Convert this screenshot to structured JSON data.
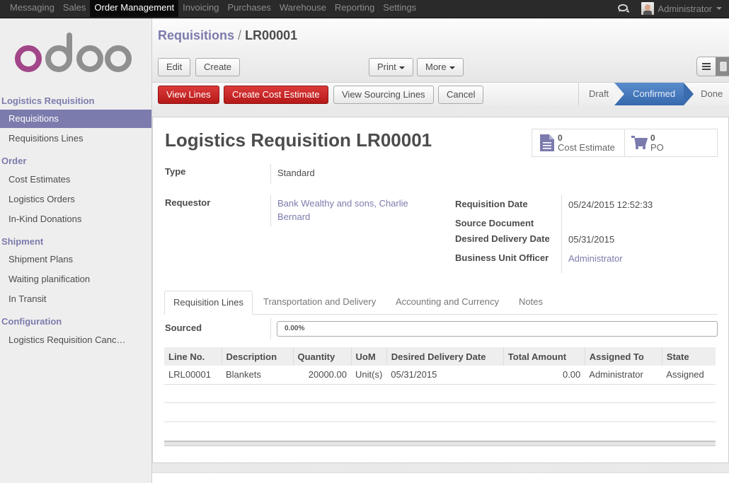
{
  "topbar": {
    "menu": [
      "Messaging",
      "Sales",
      "Order Management",
      "Invoicing",
      "Purchases",
      "Warehouse",
      "Reporting",
      "Settings"
    ],
    "active_menu": "Order Management",
    "user": "Administrator",
    "icons": {
      "chat": "chat-bubbles-icon",
      "avatar": "user-avatar",
      "user_menu": "caret-down-icon"
    }
  },
  "sidebar": {
    "logo_text": "odoo",
    "sections": [
      {
        "heading": "Logistics Requisition",
        "items": [
          "Requisitions",
          "Requisitions Lines"
        ]
      },
      {
        "heading": "Order",
        "items": [
          "Cost Estimates",
          "Logistics Orders",
          "In-Kind Donations"
        ]
      },
      {
        "heading": "Shipment",
        "items": [
          "Shipment Plans",
          "Waiting planification",
          "In Transit"
        ]
      },
      {
        "heading": "Configuration",
        "items": [
          "Logistics Requisition Canc…"
        ]
      }
    ],
    "active_item": "Requisitions"
  },
  "breadcrumb": {
    "parent": "Requisitions",
    "separator": "/",
    "current": "LR00001"
  },
  "toolbar": {
    "edit": "Edit",
    "create": "Create",
    "print": "Print",
    "more": "More",
    "view_switcher": [
      "list-view-icon",
      "form-view-icon"
    ]
  },
  "actions": {
    "view_lines": "View Lines",
    "create_cost_estimate": "Create Cost Estimate",
    "view_sourcing_lines": "View Sourcing Lines",
    "cancel": "Cancel"
  },
  "statusbar": {
    "stages": [
      "Draft",
      "Confirmed",
      "Done"
    ],
    "current": "Confirmed"
  },
  "record": {
    "title_prefix": "Logistics Requisition",
    "title_number": "LR00001",
    "smart_buttons": [
      {
        "count": "0",
        "label": "Cost Estimate",
        "icon": "document-icon"
      },
      {
        "count": "0",
        "label": "PO",
        "icon": "shopping-cart-icon"
      }
    ],
    "fields": {
      "type": {
        "label": "Type",
        "value": "Standard"
      },
      "requestor": {
        "label": "Requestor",
        "value": "Bank Wealthy and sons, Charlie Bernard",
        "value_line1": "Bank Wealthy and sons, Charlie",
        "value_line2": "Bernard"
      },
      "requisition_date": {
        "label": "Requisition Date",
        "value": "05/24/2015 12:52:33"
      },
      "source_document": {
        "label": "Source Document",
        "value": ""
      },
      "desired_delivery_date": {
        "label": "Desired Delivery Date",
        "value": "05/31/2015"
      },
      "business_unit_officer": {
        "label": "Business Unit Officer",
        "value": "Administrator"
      }
    },
    "tabs": [
      "Requisition Lines",
      "Transportation and Delivery",
      "Accounting and Currency",
      "Notes"
    ],
    "active_tab": "Requisition Lines",
    "sourced": {
      "label": "Sourced",
      "value": "0.00%",
      "percent": 0
    },
    "lines": {
      "columns": [
        "Line No.",
        "Description",
        "Quantity",
        "UoM",
        "Desired Delivery Date",
        "Total Amount",
        "Assigned To",
        "State"
      ],
      "rows": [
        [
          "LRL00001",
          "Blankets",
          "20000.00",
          "Unit(s)",
          "05/31/2015",
          "0.00",
          "Administrator",
          "Assigned"
        ]
      ]
    }
  },
  "colors": {
    "brand": "#7c7bad",
    "danger": "#c52020",
    "status_active": "#3f6eaf",
    "logo_o": "#a24689",
    "logo_gray": "#8f8f8f"
  }
}
